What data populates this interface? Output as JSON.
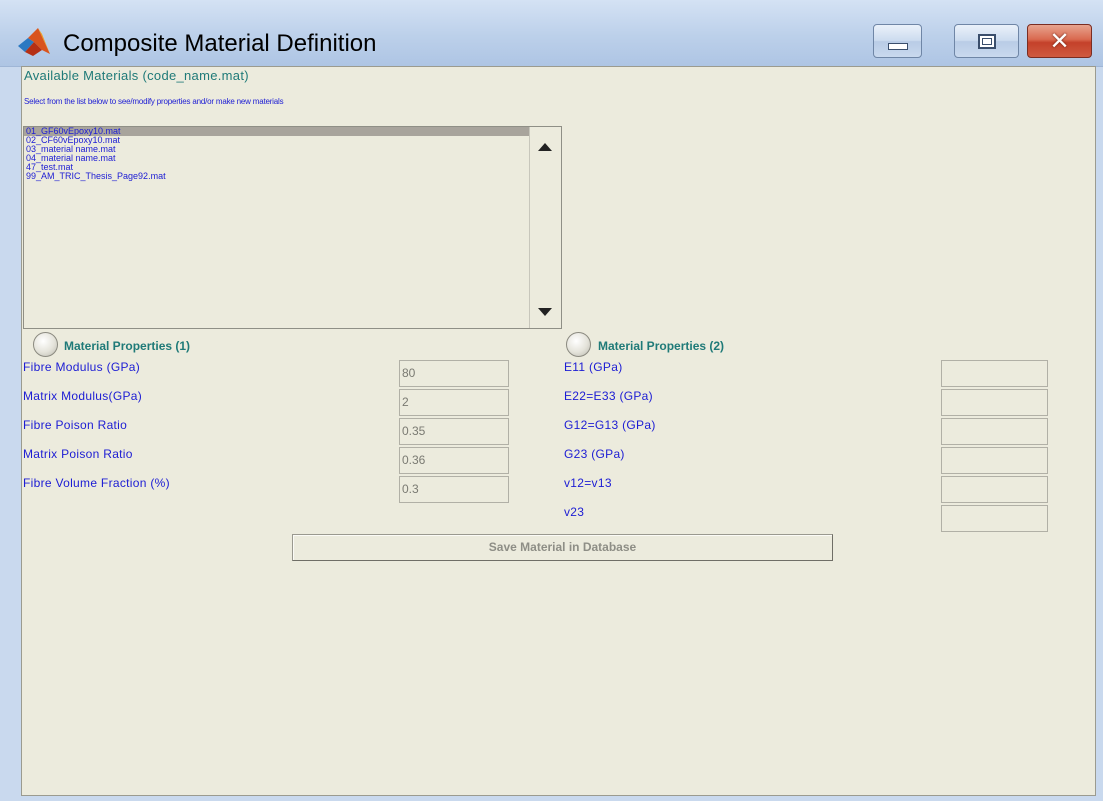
{
  "window": {
    "title": "Composite Material Definition",
    "app_icon": "matlab-logo-icon",
    "controls": {
      "minimize_icon": "minimize-icon",
      "maximize_icon": "maximize-icon",
      "close_icon": "close-icon",
      "close_glyph": "✕"
    }
  },
  "materials": {
    "header": "Available Materials (code_name.mat)",
    "hint": "Select from the list below to see/modify properties and/or make new materials",
    "items": [
      {
        "label": "01_GF60vEpoxy10.mat",
        "selected": true
      },
      {
        "label": "02_CF60vEpoxy10.mat",
        "selected": false
      },
      {
        "label": "03_material name.mat",
        "selected": false
      },
      {
        "label": "04_material name.mat",
        "selected": false
      },
      {
        "label": "47_test.mat",
        "selected": false
      },
      {
        "label": "99_AM_TRIC_Thesis_Page92.mat",
        "selected": false
      }
    ]
  },
  "props1": {
    "title": "Material Properties (1)",
    "fields": [
      {
        "label": "Fibre Modulus (GPa)",
        "value": "80"
      },
      {
        "label": "Matrix Modulus(GPa)",
        "value": "2"
      },
      {
        "label": "Fibre Poison Ratio",
        "value": "0.35"
      },
      {
        "label": "Matrix Poison Ratio",
        "value": "0.36"
      },
      {
        "label": "Fibre Volume Fraction (%)",
        "value": "0.3"
      }
    ]
  },
  "props2": {
    "title": "Material Properties (2)",
    "fields": [
      {
        "label": "E11 (GPa)",
        "value": ""
      },
      {
        "label": "E22=E33 (GPa)",
        "value": ""
      },
      {
        "label": "G12=G13 (GPa)",
        "value": ""
      },
      {
        "label": "G23 (GPa)",
        "value": ""
      },
      {
        "label": "v12=v13",
        "value": ""
      },
      {
        "label": "v23",
        "value": ""
      }
    ]
  },
  "actions": {
    "save_label": "Save Material in Database"
  },
  "colors": {
    "label_blue": "#1c1cd4",
    "header_teal": "#1f7a78",
    "panel_bg": "#ecebdd",
    "close_red": "#c4412a"
  }
}
